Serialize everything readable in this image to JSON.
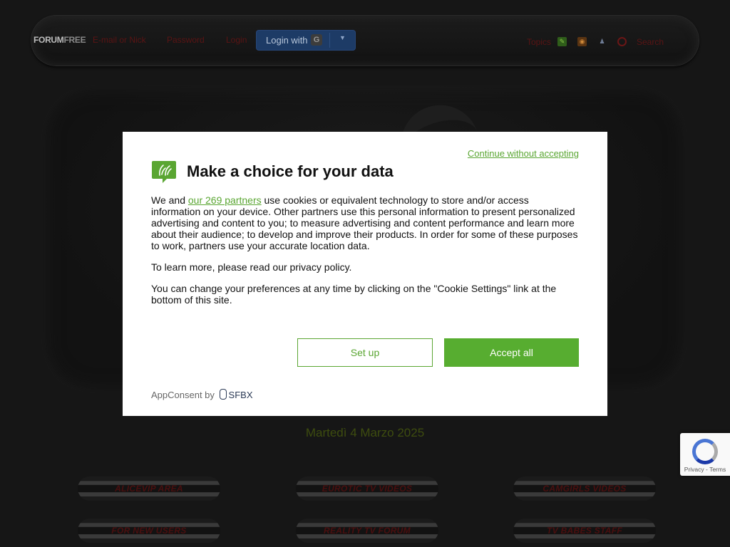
{
  "topbar": {
    "brand_a": "FORUM",
    "brand_b": "FREE",
    "email_placeholder": "E-mail or Nick",
    "password_placeholder": "Password",
    "login_label": "Login",
    "login_with_label": "Login with",
    "google_glyph": "G",
    "dropdown_glyph": "▼",
    "topics_label": "Topics",
    "search_label": "Search",
    "colors": {
      "link": "#5a1414",
      "login_with_bg": "#1d3b66"
    }
  },
  "date": "Martedì 4 Marzo 2025",
  "nav": {
    "row1": [
      "ALICEVIP AREA",
      "EUROTIC TV VIDEOS",
      "CAMGIRLS VIDEOS"
    ],
    "row2": [
      "FOR NEW USERS",
      "REALITY TV FORUM",
      "TV BABES STAFF"
    ]
  },
  "consent": {
    "continue_label": "Continue without accepting",
    "title": "Make a choice for your data",
    "para1_before": "We and ",
    "para1_link": "our 269 partners",
    "para1_after": " use cookies or equivalent technology to store and/or access information on your device. Other partners use this personal information to present personalized advertising and content to you; to measure advertising and content performance and learn more about their audience; to develop and improve their products. In order for some of these purposes to work, partners use your accurate location data.",
    "para2": "To learn more, please read our privacy policy.",
    "para3": "You can change your preferences at any time by clicking on the \"Cookie Settings\" link at the bottom of this site.",
    "setup_label": "Set up",
    "accept_label": "Accept all",
    "footer_prefix": "AppConsent by",
    "footer_brand": "SFBX",
    "accent_color": "#57ad30"
  },
  "recaptcha": {
    "text": "Privacy - Terms"
  }
}
